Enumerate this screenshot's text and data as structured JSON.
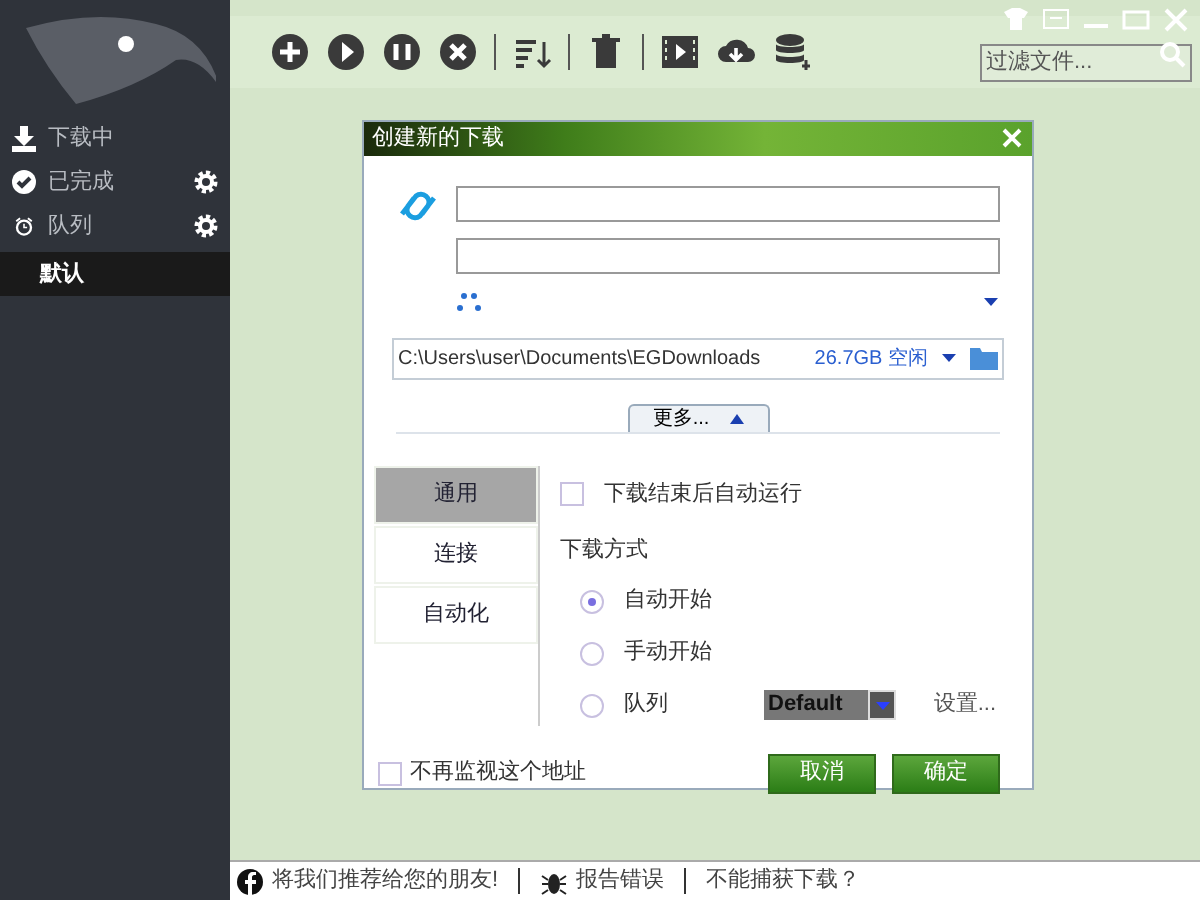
{
  "toolbar": {
    "filter": {
      "placeholder": "过滤文件..."
    }
  },
  "sidebar": {
    "items": [
      {
        "label": "下载中",
        "settings": false,
        "selected": false
      },
      {
        "label": "已完成",
        "settings": true,
        "selected": false
      },
      {
        "label": "队列",
        "settings": true,
        "selected": false,
        "children": [
          {
            "label": "默认",
            "selected": true
          }
        ]
      }
    ]
  },
  "dialog": {
    "title": "创建新的下载",
    "path": "C:\\Users\\user\\Documents\\EGDownloads",
    "free_space": "26.7GB 空闲",
    "more_button": "更多...",
    "tabs": [
      {
        "label": "通用",
        "selected": true
      },
      {
        "label": "连接",
        "selected": false
      },
      {
        "label": "自动化",
        "selected": false
      }
    ],
    "run_after": {
      "label": "下载结束后自动运行",
      "checked": false
    },
    "mode_label": "下载方式",
    "modes": [
      {
        "label": "自动开始",
        "selected": true
      },
      {
        "label": "手动开始",
        "selected": false
      },
      {
        "label": "队列",
        "selected": false,
        "queue": "Default",
        "settings_link": "设置..."
      }
    ],
    "dont_monitor": {
      "label": "不再监视这个地址",
      "checked": false
    },
    "buttons": [
      "取消",
      "确定"
    ]
  },
  "status_bar": [
    "将我们推荐给您的朋友!",
    "报告错误",
    "不能捕获下载？"
  ]
}
